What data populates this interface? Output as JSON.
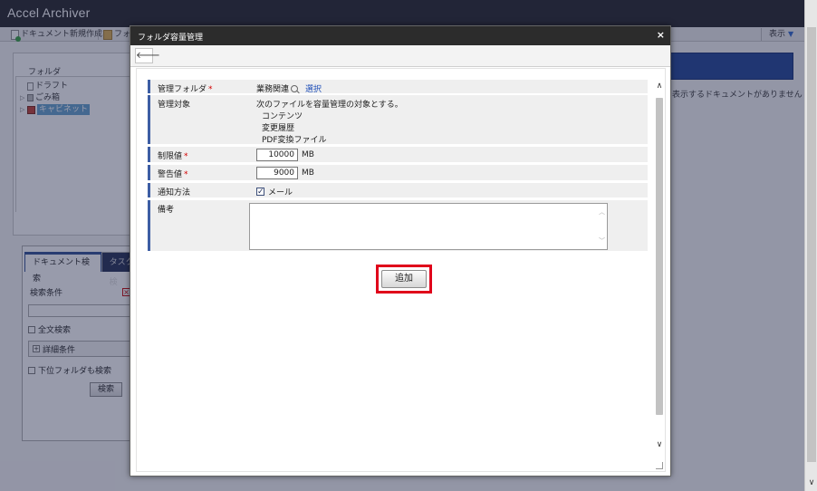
{
  "app": {
    "title": "Accel Archiver"
  },
  "toolbar": {
    "new_document_label": "ドキュメント新規作成",
    "folder_label_partial": "フォ",
    "view_menu_label": "表示"
  },
  "folder_panel": {
    "title": "フォルダ",
    "tree": [
      {
        "label": "ドラフト",
        "icon": "page-icon",
        "selected": false
      },
      {
        "label": "ごみ箱",
        "icon": "trash-icon",
        "selected": false
      },
      {
        "label": "キャビネット",
        "icon": "cabinet-icon",
        "selected": true
      }
    ]
  },
  "search_panel": {
    "tabs": [
      "ドキュメント検索",
      "タスク検"
    ],
    "condition_label": "検索条件",
    "fulltext_label": "全文検索",
    "detail_label": "詳細条件",
    "subfolder_label": "下位フォルダも検索",
    "search_button_label": "検索"
  },
  "document_list": {
    "empty_message": "表示するドキュメントがありません"
  },
  "dialog": {
    "title": "フォルダ容量管理",
    "close_label": "×",
    "back_icon": "back-arrow-icon",
    "form": {
      "folder": {
        "label": "管理フォルダ",
        "required": "*",
        "value": "業務関連",
        "select_label": "選択"
      },
      "target": {
        "label": "管理対象",
        "description": "次のファイルを容量管理の対象とする。",
        "items": [
          "コンテンツ",
          "変更履歴",
          "PDF変換ファイル"
        ]
      },
      "limit": {
        "label": "制限値",
        "required": "*",
        "value": "10000",
        "unit": "MB"
      },
      "warning": {
        "label": "警告値",
        "required": "*",
        "value": "9000",
        "unit": "MB"
      },
      "notify": {
        "label": "通知方法",
        "option_label": "メール",
        "checked": true
      },
      "remarks": {
        "label": "備考",
        "value": ""
      }
    },
    "add_button_label": "追加"
  },
  "colors": {
    "accent": "#3d5ea4",
    "highlight": "#e0001a",
    "required": "#d20000",
    "link": "#1f4fb8"
  }
}
